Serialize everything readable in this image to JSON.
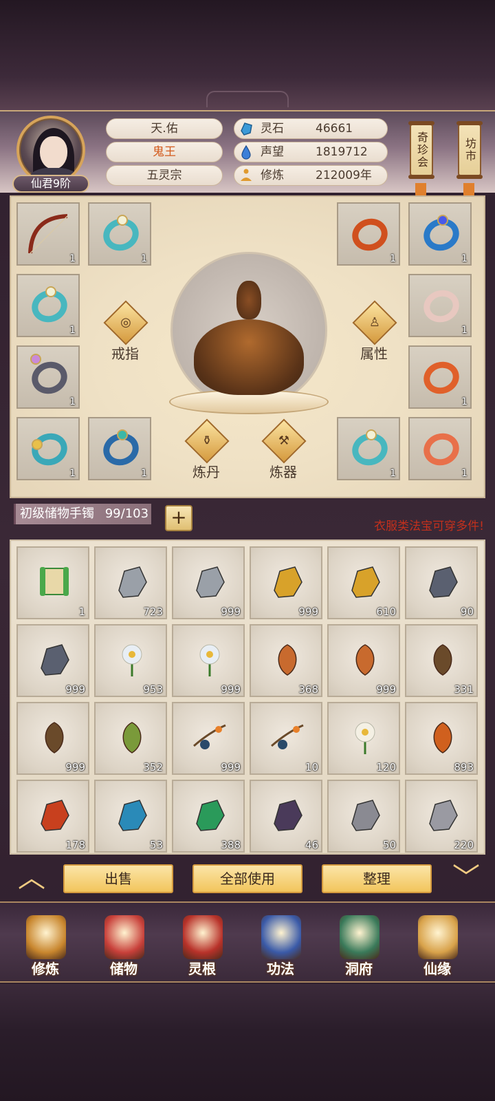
{
  "player": {
    "rank": "仙君9阶",
    "name": "天.佑",
    "title": "鬼王",
    "sect": "五灵宗"
  },
  "stats": [
    {
      "label": "灵石",
      "value": "46661",
      "icon": "spirit-stone-icon"
    },
    {
      "label": "声望",
      "value": "1819712",
      "icon": "reputation-drop-icon"
    },
    {
      "label": "修炼",
      "value": "212009年",
      "icon": "meditation-icon"
    }
  ],
  "side_tags": {
    "treasure": "奇珍会",
    "market": "坊市"
  },
  "equipment": {
    "left_slots": [
      {
        "name": "bow",
        "count": "1"
      },
      {
        "name": "jade-ring",
        "count": "1"
      },
      {
        "name": "jade-ring",
        "count": "1"
      },
      {
        "name": "pearl-ring",
        "count": "1"
      },
      {
        "name": "gold-jade-ring",
        "count": "1"
      },
      {
        "name": "blue-ring",
        "count": "1"
      }
    ],
    "right_slots": [
      {
        "name": "dragon-ring",
        "count": "1"
      },
      {
        "name": "sapphire-ring",
        "count": "1"
      },
      {
        "name": "silver-ring",
        "count": "1"
      },
      {
        "name": "phoenix-ring",
        "count": "1"
      },
      {
        "name": "jade-ring",
        "count": "1"
      },
      {
        "name": "dragon-ring",
        "count": "1"
      }
    ],
    "buttons": {
      "ring": "戒指",
      "attr": "属性",
      "alchemy": "炼丹",
      "forge": "炼器"
    }
  },
  "bag": {
    "label": "初级储物手镯",
    "capacity": "99/103",
    "plus": "+",
    "notice": "衣服类法宝可穿多件!"
  },
  "items": [
    {
      "name": "scroll",
      "count": "1",
      "color": "#4aa84a"
    },
    {
      "name": "iron-ore",
      "count": "723",
      "color": "#9aa0a8"
    },
    {
      "name": "iron-ore",
      "count": "999",
      "color": "#9aa0a8"
    },
    {
      "name": "gold-ore",
      "count": "999",
      "color": "#d8a22a"
    },
    {
      "name": "gold-ore",
      "count": "610",
      "color": "#d8a22a"
    },
    {
      "name": "dark-iron",
      "count": "90",
      "color": "#5a6070"
    },
    {
      "name": "dark-iron",
      "count": "999",
      "color": "#5a6070"
    },
    {
      "name": "white-lily",
      "count": "953",
      "color": "#e8eef4"
    },
    {
      "name": "white-lily",
      "count": "999",
      "color": "#e8eef4"
    },
    {
      "name": "ginseng",
      "count": "368",
      "color": "#c86a2e"
    },
    {
      "name": "ginseng",
      "count": "999",
      "color": "#c86a2e"
    },
    {
      "name": "herb-root",
      "count": "331",
      "color": "#6a4a2a"
    },
    {
      "name": "herb-root",
      "count": "999",
      "color": "#6a4a2a"
    },
    {
      "name": "red-bloom-herb",
      "count": "352",
      "color": "#7a9a3a"
    },
    {
      "name": "berry-branch",
      "count": "999",
      "color": "#2a4a6a"
    },
    {
      "name": "berry-branch",
      "count": "10",
      "color": "#2a4a6a"
    },
    {
      "name": "daisy",
      "count": "120",
      "color": "#f4f0e4"
    },
    {
      "name": "dragon-herb",
      "count": "893",
      "color": "#d0601e"
    },
    {
      "name": "fire-crystal",
      "count": "178",
      "color": "#c8401e"
    },
    {
      "name": "ice-crystal",
      "count": "53",
      "color": "#2a8ab8"
    },
    {
      "name": "jade-crystal",
      "count": "388",
      "color": "#2a9a5a"
    },
    {
      "name": "shadow-crystal",
      "count": "46",
      "color": "#4a3a5a"
    },
    {
      "name": "grey-stone",
      "count": "50",
      "color": "#8a8a92"
    },
    {
      "name": "grey-stone",
      "count": "220",
      "color": "#9a9aa2"
    }
  ],
  "actions": {
    "sell": "出售",
    "use_all": "全部使用",
    "sort": "整理"
  },
  "nav": [
    {
      "label": "修炼",
      "icon": "cultivate-icon",
      "color": "#c8862e"
    },
    {
      "label": "储物",
      "icon": "storage-bag-icon",
      "color": "#c8403a"
    },
    {
      "label": "灵根",
      "icon": "spirit-root-icon",
      "color": "#b8322a"
    },
    {
      "label": "功法",
      "icon": "skill-book-icon",
      "color": "#3a5aa8"
    },
    {
      "label": "洞府",
      "icon": "cave-palace-icon",
      "color": "#3a7a5a"
    },
    {
      "label": "仙缘",
      "icon": "fate-gourd-icon",
      "color": "#d8a24a"
    }
  ]
}
